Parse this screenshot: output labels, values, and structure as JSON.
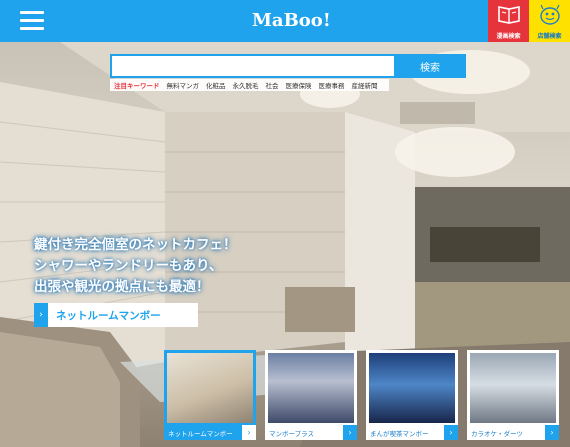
{
  "header": {
    "logo": "MaBoo!",
    "manga_search_label": "漫画検索",
    "store_search_label": "店舗検索",
    "colors": {
      "bar": "#1fa3ec",
      "manga_button": "#e6343d",
      "store_button": "#ffe100"
    }
  },
  "search": {
    "value": "",
    "button_label": "検索",
    "keywords_heading": "注目キーワード",
    "keywords": [
      "無料マンガ",
      "化粧品",
      "永久脱毛",
      "社会",
      "医療保険",
      "医療事務",
      "産経新聞"
    ]
  },
  "hero": {
    "tagline": [
      "鍵付き完全個室のネットカフェ！",
      "シャワーやランドリーもあり、",
      "出張や観光の拠点にも最適！"
    ],
    "cta_label": "ネットルームマンボー"
  },
  "thumbnails": [
    {
      "label": "ネットルームマンボー",
      "active": true
    },
    {
      "label": "マンボープラス",
      "active": false
    },
    {
      "label": "まんが喫茶マンボー",
      "active": false
    },
    {
      "label": "カラオケ・ダーツ",
      "active": false
    }
  ],
  "icons": {
    "menu": "hamburger-icon",
    "manga": "book-icon",
    "store": "store-mascot-icon",
    "arrow": "chevron-right-icon"
  }
}
